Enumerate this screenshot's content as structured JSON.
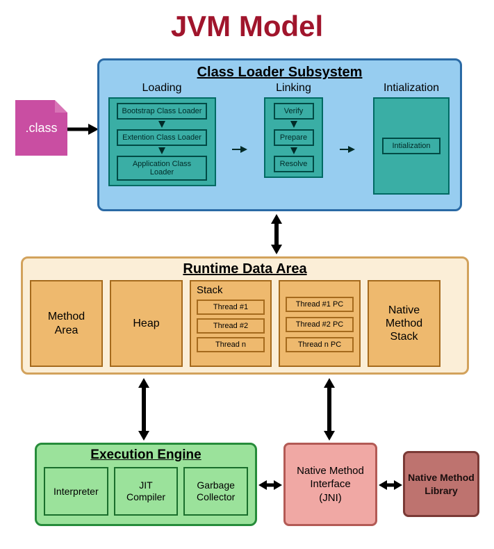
{
  "title": "JVM Model",
  "classfile_label": ".class",
  "class_loader": {
    "title": "Class Loader Subsystem",
    "loading": {
      "label": "Loading",
      "boxes": [
        "Bootstrap Class Loader",
        "Extention Class Loader",
        "Application Class Loader"
      ]
    },
    "linking": {
      "label": "Linking",
      "boxes": [
        "Verify",
        "Prepare",
        "Resolve"
      ]
    },
    "initialization": {
      "label": "Intialization",
      "box": "Intialization"
    }
  },
  "runtime_data_area": {
    "title": "Runtime Data Area",
    "method_area": "Method\nArea",
    "heap": "Heap",
    "stack": {
      "label": "Stack",
      "items": [
        "Thread #1",
        "Thread #2",
        "Thread n"
      ]
    },
    "pc": {
      "items": [
        "Thread #1 PC",
        "Thread #2 PC",
        "Thread n PC"
      ]
    },
    "native_method_stack": "Native\nMethod\nStack"
  },
  "execution_engine": {
    "title": "Execution Engine",
    "boxes": [
      "Interpreter",
      "JIT\nCompiler",
      "Garbage\nCollector"
    ]
  },
  "jni": "Native Method\nInterface\n(JNI)",
  "native_method_library": "Native Method\nLibrary"
}
